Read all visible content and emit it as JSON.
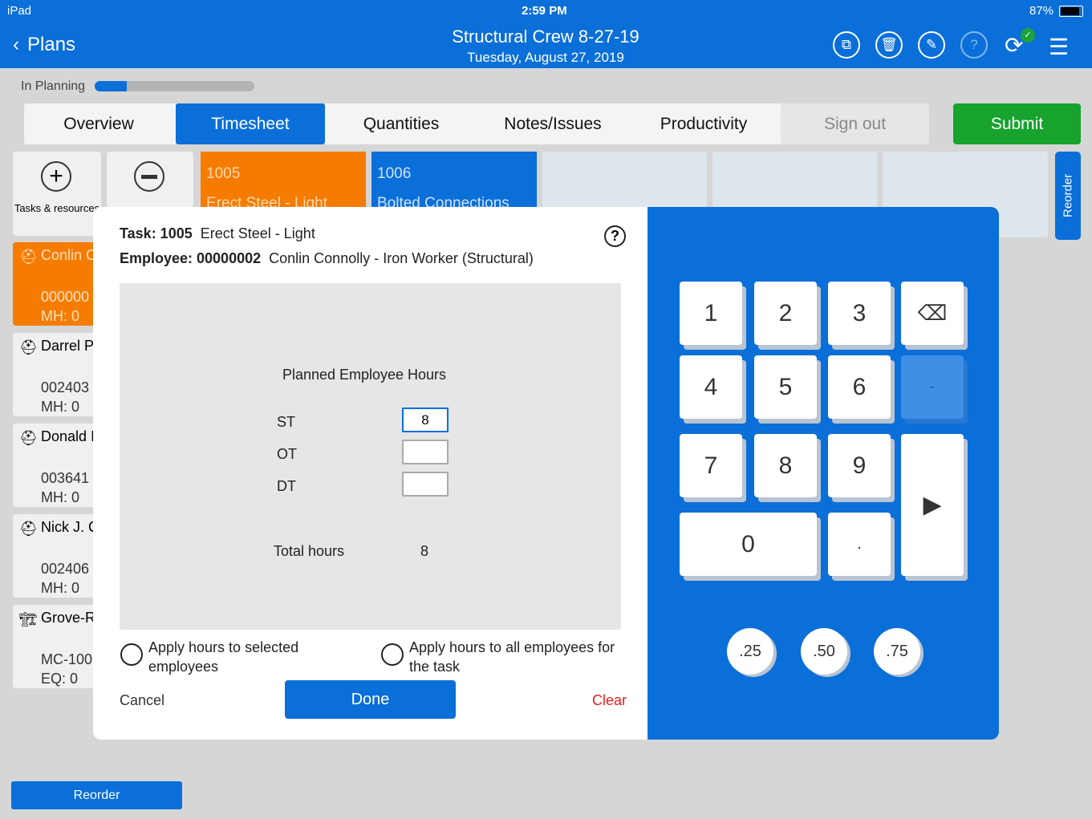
{
  "status": {
    "device": "iPad",
    "time": "2:59 PM",
    "battery": "87%"
  },
  "header": {
    "back_label": "Plans",
    "title": "Structural Crew 8-27-19",
    "subtitle": "Tuesday, August 27, 2019"
  },
  "progress": {
    "label": "In Planning",
    "value_percent": 17
  },
  "tabs": [
    {
      "label": "Overview"
    },
    {
      "label": "Timesheet",
      "active": true
    },
    {
      "label": "Quantities"
    },
    {
      "label": "Notes/Issues"
    },
    {
      "label": "Productivity"
    },
    {
      "label": "Sign out"
    }
  ],
  "submit_label": "Submit",
  "tasks_label": "Tasks & resources",
  "task_cards": [
    {
      "code": "1005",
      "name": "Erect Steel - Light",
      "color": "#f57c00"
    },
    {
      "code": "1006",
      "name": "Bolted Connections",
      "color": "#0a6fd8"
    }
  ],
  "reorder_side": "Reorder",
  "reorder_bottom": "Reorder",
  "employees": [
    {
      "name": "Conlin C",
      "id": "000000",
      "mh": "MH: 0"
    },
    {
      "name": "Darrel P.",
      "id": "002403",
      "mh": "MH: 0"
    },
    {
      "name": "Donald I",
      "id": "003641",
      "mh": "MH: 0"
    },
    {
      "name": "Nick J. C",
      "id": "002406",
      "mh": "MH: 0"
    },
    {
      "name": "Grove-R",
      "id": "MC-100",
      "mh": "EQ:  0"
    }
  ],
  "dialog": {
    "task_label": "Task: 1005",
    "task_name": "Erect Steel - Light",
    "employee_label": "Employee: 00000002",
    "employee_name": "Conlin Connolly - Iron Worker (Structural)",
    "section_title": "Planned Employee Hours",
    "st_label": "ST",
    "st_value": "8",
    "ot_label": "OT",
    "ot_value": "",
    "dt_label": "DT",
    "dt_value": "",
    "total_label": "Total hours",
    "total_value": "8",
    "apply_selected": "Apply hours to selected employees",
    "apply_all": "Apply hours to all employees for the task",
    "cancel": "Cancel",
    "done": "Done",
    "clear": "Clear"
  },
  "keypad": {
    "keys": [
      "1",
      "2",
      "3",
      "4",
      "5",
      "6",
      "7",
      "8",
      "9",
      "0",
      "."
    ],
    "minus": "-",
    "quick": [
      ".25",
      ".50",
      ".75"
    ]
  }
}
